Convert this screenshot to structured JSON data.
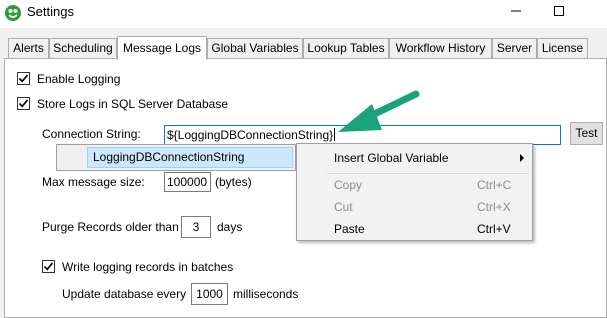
{
  "window": {
    "title": "Settings"
  },
  "tabs": [
    {
      "label": "Alerts",
      "active": false
    },
    {
      "label": "Scheduling",
      "active": false
    },
    {
      "label": "Message Logs",
      "active": true
    },
    {
      "label": "Global Variables",
      "active": false
    },
    {
      "label": "Lookup Tables",
      "active": false
    },
    {
      "label": "Workflow History",
      "active": false
    },
    {
      "label": "Server",
      "active": false
    },
    {
      "label": "License",
      "active": false
    }
  ],
  "logging": {
    "enable_label": "Enable Logging",
    "enable_checked": true,
    "store_label": "Store Logs in SQL Server Database",
    "store_checked": true,
    "connection_label": "Connection String:",
    "connection_value": "${LoggingDBConnectionString}",
    "test_button": "Test",
    "max_size_label": "Max message size:",
    "max_size_value": "100000",
    "max_size_unit": "(bytes)",
    "purge_label": "Purge Records older than",
    "purge_value": "3",
    "purge_unit": "days",
    "batch_label": "Write logging records in batches",
    "batch_checked": true,
    "update_label": "Update database every",
    "update_value": "1000",
    "update_unit": "milliseconds"
  },
  "autocomplete": {
    "item": "LoggingDBConnectionString"
  },
  "context_menu": {
    "insert_variable": "Insert Global Variable",
    "copy": "Copy",
    "copy_shortcut": "Ctrl+C",
    "cut": "Cut",
    "cut_shortcut": "Ctrl+X",
    "paste": "Paste",
    "paste_shortcut": "Ctrl+V"
  },
  "colors": {
    "accent": "#0078d7",
    "arrow": "#1aa37a",
    "selection": "#cce8ff",
    "app_icon": "#2e9b3c"
  }
}
